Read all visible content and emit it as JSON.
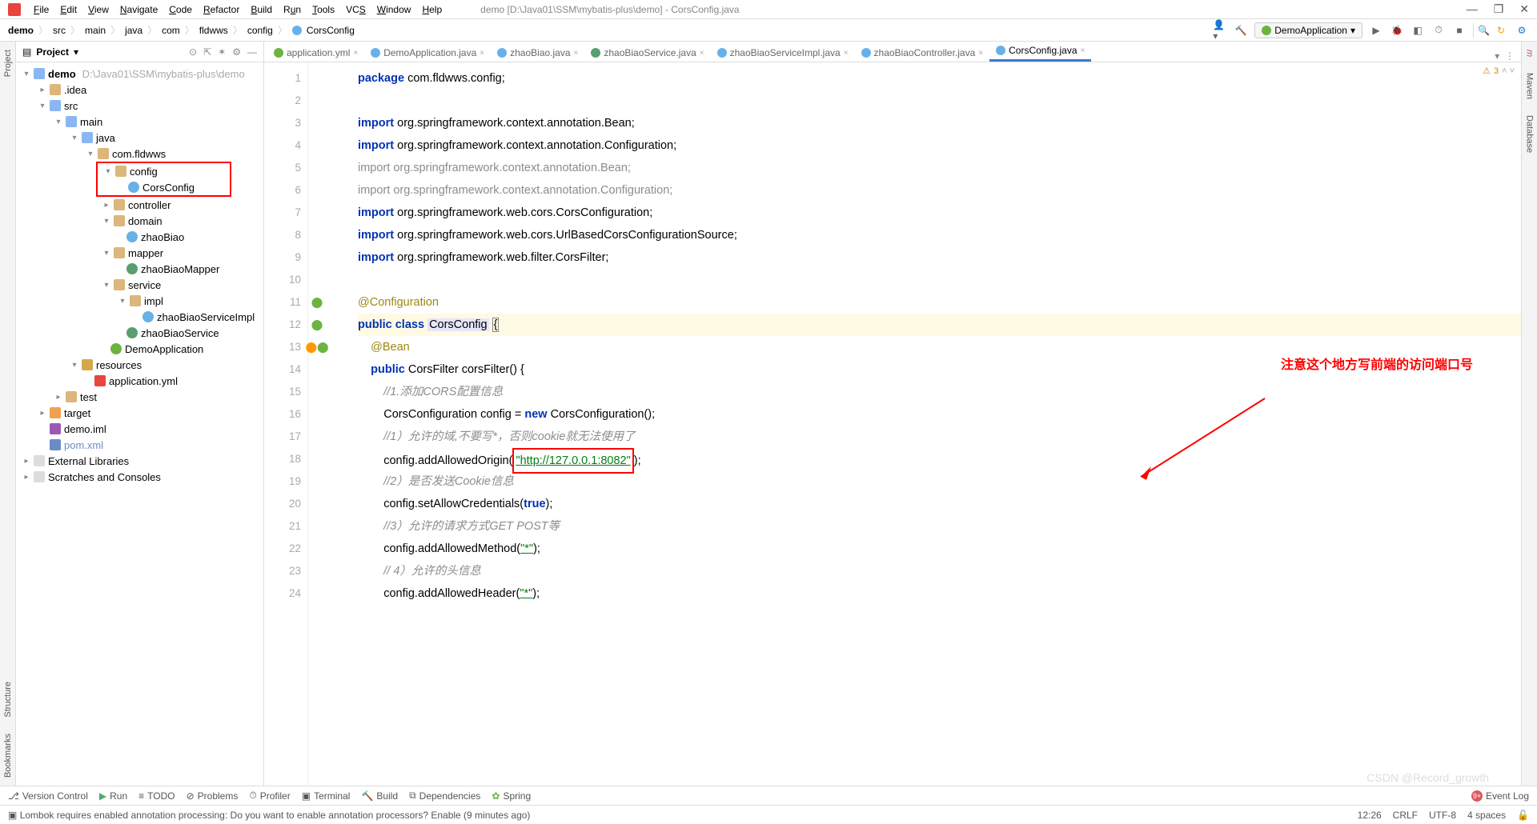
{
  "menu": {
    "items": [
      "File",
      "Edit",
      "View",
      "Navigate",
      "Code",
      "Refactor",
      "Build",
      "Run",
      "Tools",
      "VCS",
      "Window",
      "Help"
    ],
    "title": "demo [D:\\Java01\\SSM\\mybatis-plus\\demo] - CorsConfig.java"
  },
  "breadcrumb": [
    "demo",
    "src",
    "main",
    "java",
    "com",
    "fldwws",
    "config",
    "CorsConfig"
  ],
  "run_config": "DemoApplication",
  "project": {
    "title": "Project",
    "root": {
      "name": "demo",
      "path": "D:\\Java01\\SSM\\mybatis-plus\\demo"
    },
    "libs": "External Libraries",
    "scratches": "Scratches and Consoles",
    "tree": [
      ".idea",
      "src",
      "main",
      "java",
      "com.fldwws",
      "config",
      "CorsConfig",
      "controller",
      "domain",
      "zhaoBiao",
      "mapper",
      "zhaoBiaoMapper",
      "service",
      "impl",
      "zhaoBiaoServiceImpl",
      "zhaoBiaoService",
      "DemoApplication",
      "resources",
      "application.yml",
      "test",
      "target",
      "demo.iml",
      "pom.xml"
    ]
  },
  "tabs": [
    {
      "name": "application.yml",
      "ic": "ic-yml"
    },
    {
      "name": "DemoApplication.java",
      "ic": "ic-java"
    },
    {
      "name": "zhaoBiao.java",
      "ic": "ic-java"
    },
    {
      "name": "zhaoBiaoService.java",
      "ic": "ic-int"
    },
    {
      "name": "zhaoBiaoServiceImpl.java",
      "ic": "ic-java"
    },
    {
      "name": "zhaoBiaoController.java",
      "ic": "ic-java"
    },
    {
      "name": "CorsConfig.java",
      "ic": "ic-java",
      "active": true
    }
  ],
  "warnings": "3",
  "callout": "注意这个地方写前端的访问端口号",
  "code": {
    "l1": {
      "pkg": "package",
      "body": " com.fldwws.config;"
    },
    "l3": {
      "kw": "import",
      "body": " org.springframework.context.annotation.",
      "cls": "Bean",
      "end": ";"
    },
    "l4": {
      "kw": "import",
      "body": " org.springframework.context.annotation.",
      "cls": "Configuration",
      "end": ";"
    },
    "l5": "import org.springframework.context.annotation.Bean;",
    "l6": "import org.springframework.context.annotation.Configuration;",
    "l7": {
      "kw": "import",
      "body": " org.springframework.web.cors.CorsConfiguration;"
    },
    "l8": {
      "kw": "import",
      "body": " org.springframework.web.cors.UrlBasedCorsConfigurationSource;"
    },
    "l9": {
      "kw": "import",
      "body": " org.springframework.web.filter.CorsFilter;"
    },
    "l11": "@Configuration",
    "l12": {
      "pub": "public",
      "cls": "class",
      "name": "CorsConfig",
      "brace": "{"
    },
    "l13": "@Bean",
    "l14": {
      "pub": "public",
      "ret": " CorsFilter corsFilter() {"
    },
    "l15": "//1.添加CORS配置信息",
    "l16": {
      "a": "CorsConfiguration config = ",
      "new": "new",
      "b": " CorsConfiguration();"
    },
    "l17": "//1）允许的域,不要写*，否则cookie就无法使用了",
    "l18": {
      "a": "config.addAllowedOrigin(",
      "str": "\"http://127.0.0.1:8082\"",
      "b": ");"
    },
    "l19": "//2）是否发送Cookie信息",
    "l20": {
      "a": "config.setAllowCredentials(",
      "kw": "true",
      "b": ");"
    },
    "l21": "//3）允许的请求方式GET POST等",
    "l22": {
      "a": "config.addAllowedMethod(",
      "str": "\"*\"",
      "b": ");"
    },
    "l23": "// 4）允许的头信息",
    "l24": {
      "a": "config.addAllowedHeader(",
      "str": "\"*\"",
      "b": ");"
    }
  },
  "bottom": {
    "items": [
      "Version Control",
      "Run",
      "TODO",
      "Problems",
      "Profiler",
      "Terminal",
      "Build",
      "Dependencies",
      "Spring"
    ],
    "event": "Event Log"
  },
  "status": {
    "msg": "Lombok requires enabled annotation processing: Do you want to enable annotation processors? Enable (9 minutes ago)",
    "pos": "12:26",
    "lf": "CRLF",
    "enc": "UTF-8",
    "indent": "4 spaces"
  },
  "sidetabs_left": [
    "Project",
    "Structure",
    "Bookmarks"
  ],
  "sidetabs_right": [
    "Maven",
    "Database"
  ],
  "watermark": "CSDN @Record_growth"
}
